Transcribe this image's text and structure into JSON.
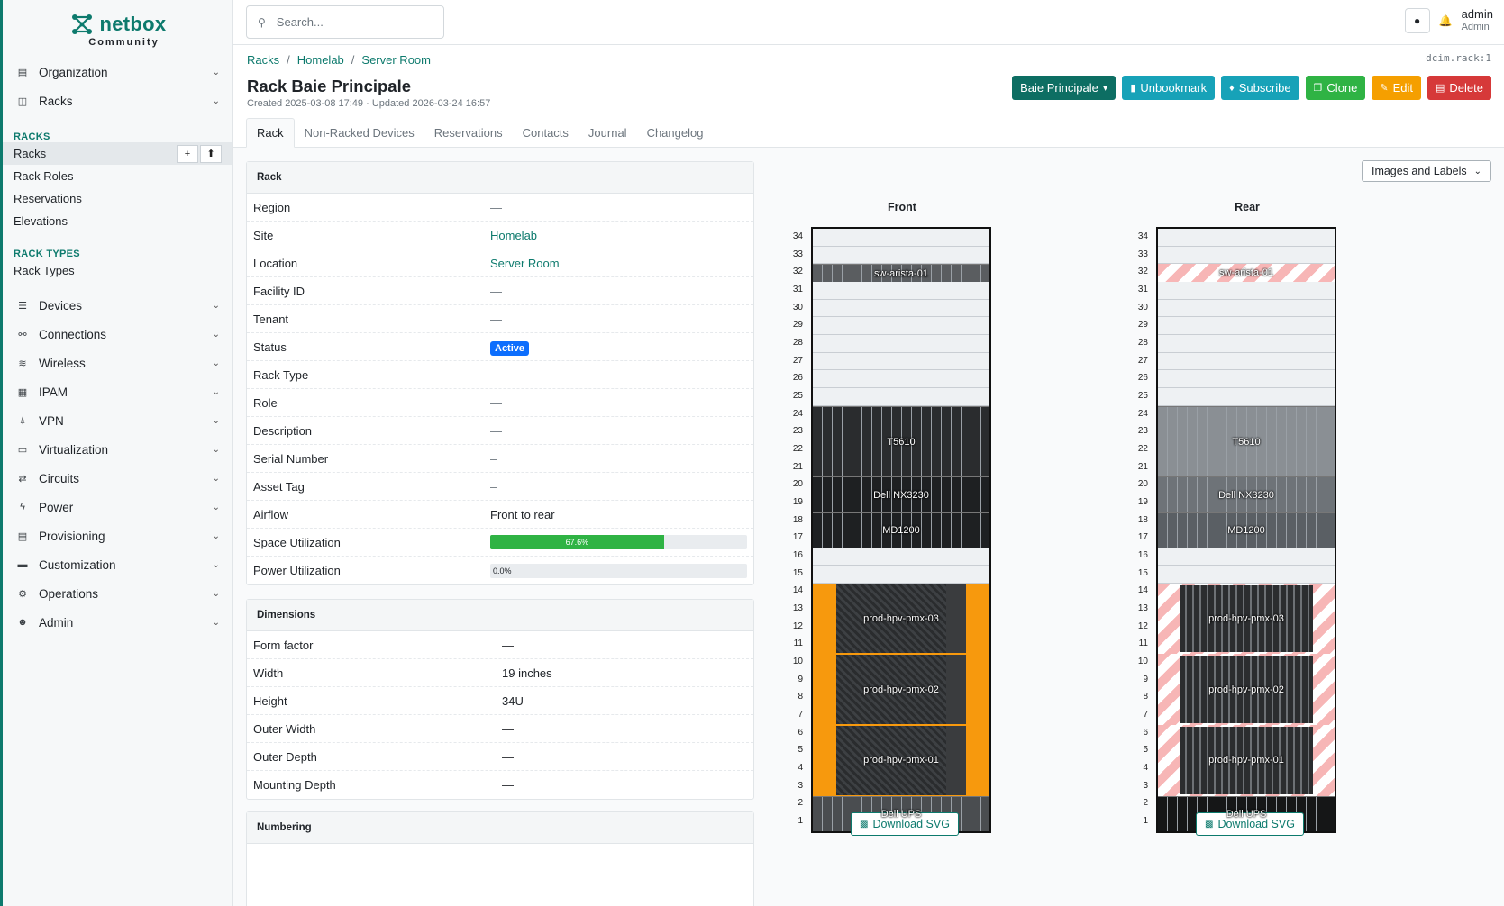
{
  "app": {
    "name": "netbox",
    "edition": "Community"
  },
  "search": {
    "placeholder": "Search..."
  },
  "user": {
    "name": "admin",
    "role": "Admin"
  },
  "sidebar": {
    "top_items": [
      {
        "label": "Organization",
        "icon": "building-icon"
      },
      {
        "label": "Racks",
        "icon": "rack-icon"
      }
    ],
    "racks_section": "RACKS",
    "racks_items": [
      "Racks",
      "Rack Roles",
      "Reservations",
      "Elevations"
    ],
    "racktypes_section": "RACK TYPES",
    "racktypes_items": [
      "Rack Types"
    ],
    "bottom_items": [
      {
        "label": "Devices",
        "icon": "server-icon"
      },
      {
        "label": "Connections",
        "icon": "connection-icon"
      },
      {
        "label": "Wireless",
        "icon": "wifi-icon"
      },
      {
        "label": "IPAM",
        "icon": "ip-icon"
      },
      {
        "label": "VPN",
        "icon": "vpn-icon"
      },
      {
        "label": "Virtualization",
        "icon": "monitor-icon"
      },
      {
        "label": "Circuits",
        "icon": "circuit-icon"
      },
      {
        "label": "Power",
        "icon": "bolt-icon"
      },
      {
        "label": "Provisioning",
        "icon": "file-icon"
      },
      {
        "label": "Customization",
        "icon": "toolbox-icon"
      },
      {
        "label": "Operations",
        "icon": "cogs-icon"
      },
      {
        "label": "Admin",
        "icon": "users-icon"
      }
    ],
    "add_glyph": "+",
    "import_glyph": "⬆"
  },
  "breadcrumb": [
    "Racks",
    "Homelab",
    "Server Room"
  ],
  "object_id": "dcim.rack:1",
  "page_title": "Rack Baie Principale",
  "meta": "Created 2025-03-08 17:49 · Updated 2026-03-24 16:57",
  "actions": {
    "dropdown": "Baie Principale",
    "unbookmark": "Unbookmark",
    "subscribe": "Subscribe",
    "clone": "Clone",
    "edit": "Edit",
    "delete": "Delete"
  },
  "tabs": [
    "Rack",
    "Non-Racked Devices",
    "Reservations",
    "Contacts",
    "Journal",
    "Changelog"
  ],
  "rack_card": {
    "title": "Rack",
    "rows": [
      {
        "k": "Region",
        "v": "—"
      },
      {
        "k": "Site",
        "v": "Homelab"
      },
      {
        "k": "Location",
        "v": "Server Room"
      },
      {
        "k": "Facility ID",
        "v": "—"
      },
      {
        "k": "Tenant",
        "v": "—"
      },
      {
        "k": "Status",
        "v": "Active"
      },
      {
        "k": "Rack Type",
        "v": "—"
      },
      {
        "k": "Role",
        "v": "—"
      },
      {
        "k": "Description",
        "v": "—"
      },
      {
        "k": "Serial Number",
        "v": "–"
      },
      {
        "k": "Asset Tag",
        "v": "–"
      },
      {
        "k": "Airflow",
        "v": "Front to rear"
      },
      {
        "k": "Space Utilization",
        "v": "67.6%",
        "percent": 67.6
      },
      {
        "k": "Power Utilization",
        "v": "0.0%",
        "percent": 0
      }
    ]
  },
  "dimensions_card": {
    "title": "Dimensions",
    "rows": [
      {
        "k": "Form factor",
        "v": "—"
      },
      {
        "k": "Width",
        "v": "19 inches"
      },
      {
        "k": "Height",
        "v": "34U"
      },
      {
        "k": "Outer Width",
        "v": "—"
      },
      {
        "k": "Outer Depth",
        "v": "—"
      },
      {
        "k": "Mounting Depth",
        "v": "—"
      }
    ]
  },
  "numbering_card": {
    "title": "Numbering"
  },
  "view_select": "Images and Labels",
  "elevation": {
    "front_title": "Front",
    "rear_title": "Rear",
    "units": 34,
    "download": "Download SVG",
    "devices": [
      {
        "name": "sw-arista-01",
        "u_bottom": 32,
        "height": 1,
        "front_color": "#5a5d60",
        "rear_color": "stripe"
      },
      {
        "name": "T5610",
        "u_bottom": 21,
        "height": 4,
        "front_color": "#2a2c2e",
        "rear_color": "#8a8f94"
      },
      {
        "name": "Dell NX3230",
        "u_bottom": 19,
        "height": 2,
        "front_color": "#1e2022",
        "rear_color": "#6e7378"
      },
      {
        "name": "MD1200",
        "u_bottom": 17,
        "height": 2,
        "front_color": "#1e2022",
        "rear_color": "#5a5f64"
      },
      {
        "name": "prod-hpv-pmx-03",
        "u_bottom": 11,
        "height": 4,
        "front_color": "orange",
        "rear_color": "stripe"
      },
      {
        "name": "prod-hpv-pmx-02",
        "u_bottom": 7,
        "height": 4,
        "front_color": "orange",
        "rear_color": "stripe"
      },
      {
        "name": "prod-hpv-pmx-01",
        "u_bottom": 3,
        "height": 4,
        "front_color": "orange",
        "rear_color": "stripe"
      },
      {
        "name": "Dell UPS",
        "u_bottom": 1,
        "height": 2,
        "front_color": "#4a4d50",
        "rear_color": "#151617"
      }
    ]
  }
}
